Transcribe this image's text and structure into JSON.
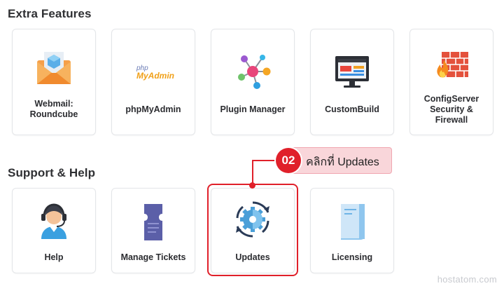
{
  "sections": {
    "extra_features": {
      "title": "Extra Features"
    },
    "support_help": {
      "title": "Support & Help"
    }
  },
  "extra_features": [
    {
      "label_line1": "Webmail:",
      "label_line2": "Roundcube",
      "icon": "webmail-envelope-icon"
    },
    {
      "label": "phpMyAdmin",
      "logo_php": "php",
      "logo_myadmin": "MyAdmin",
      "icon": "phpmyadmin-logo"
    },
    {
      "label": "Plugin Manager",
      "icon": "plugin-network-icon"
    },
    {
      "label": "CustomBuild",
      "icon": "monitor-icon"
    },
    {
      "label_line1": "ConfigServer",
      "label_line2": "Security &",
      "label_line3": "Firewall",
      "icon": "firewall-icon"
    }
  ],
  "support_help": [
    {
      "label": "Help",
      "icon": "support-agent-icon"
    },
    {
      "label": "Manage Tickets",
      "icon": "ticket-icon"
    },
    {
      "label": "Updates",
      "icon": "updates-gear-icon"
    },
    {
      "label": "Licensing",
      "icon": "license-scroll-icon"
    }
  ],
  "callout": {
    "step": "02",
    "text": "คลิกที่ Updates",
    "color": "#e0202a",
    "bg_color": "#f9d6da"
  },
  "watermark": "hostatom.com"
}
